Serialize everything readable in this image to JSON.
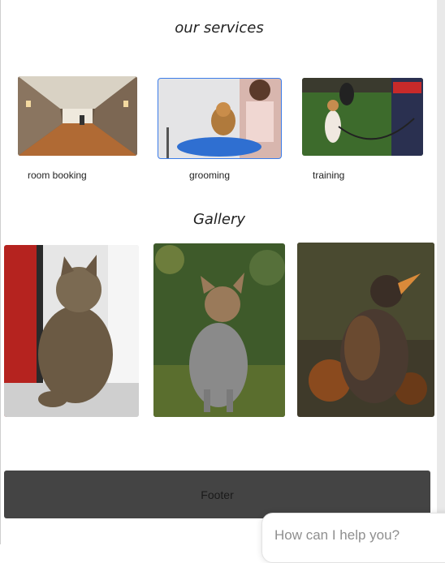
{
  "services": {
    "heading": "our services",
    "items": [
      {
        "label": "room booking",
        "icon": "hotel-corridor-photo"
      },
      {
        "label": "grooming",
        "icon": "dog-grooming-photo"
      },
      {
        "label": "training",
        "icon": "dog-training-photo"
      }
    ]
  },
  "gallery": {
    "heading": "Gallery",
    "items": [
      {
        "icon": "cat-photo"
      },
      {
        "icon": "fox-photo"
      },
      {
        "icon": "bird-photo"
      }
    ]
  },
  "footer": {
    "label": "Footer"
  },
  "chat": {
    "placeholder": "How can I help you?"
  },
  "colors": {
    "footer_bg": "#444444",
    "selection_outline": "#3c7ce8"
  }
}
